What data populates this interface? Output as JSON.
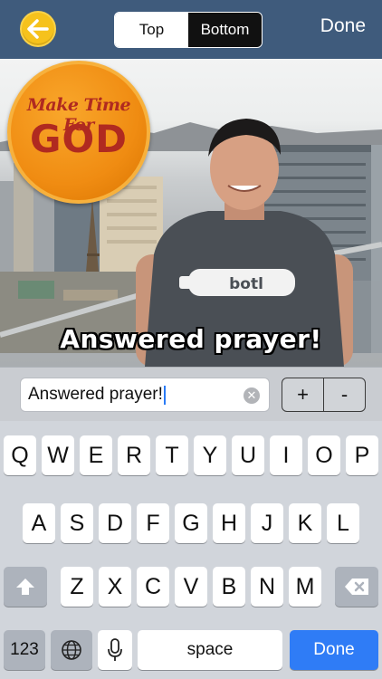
{
  "navbar": {
    "back_icon": "arrow-left-icon",
    "segments": [
      "Top",
      "Bottom"
    ],
    "selected_segment": "Bottom",
    "done_label": "Done"
  },
  "meme": {
    "badge_line1": "Make Time For",
    "badge_line2": "GOD",
    "caption": "Answered prayer!"
  },
  "entry": {
    "value": "Answered prayer!",
    "clear_icon": "clear-icon",
    "plus_label": "+",
    "minus_label": "-"
  },
  "keyboard": {
    "row1": [
      "Q",
      "W",
      "E",
      "R",
      "T",
      "Y",
      "U",
      "I",
      "O",
      "P"
    ],
    "row2": [
      "A",
      "S",
      "D",
      "F",
      "G",
      "H",
      "J",
      "K",
      "L"
    ],
    "row3": [
      "Z",
      "X",
      "C",
      "V",
      "B",
      "N",
      "M"
    ],
    "numbers_label": "123",
    "space_label": "space",
    "done_label": "Done",
    "shift_icon": "shift-arrow-icon",
    "delete_icon": "backspace-icon",
    "globe_icon": "globe-icon",
    "mic_icon": "microphone-icon"
  },
  "colors": {
    "navbar": "#3f5b7c",
    "back_button": "#f6c21c",
    "done_key": "#2f7cf6",
    "badge": "#f08c12",
    "badge_text": "#b02a20"
  }
}
